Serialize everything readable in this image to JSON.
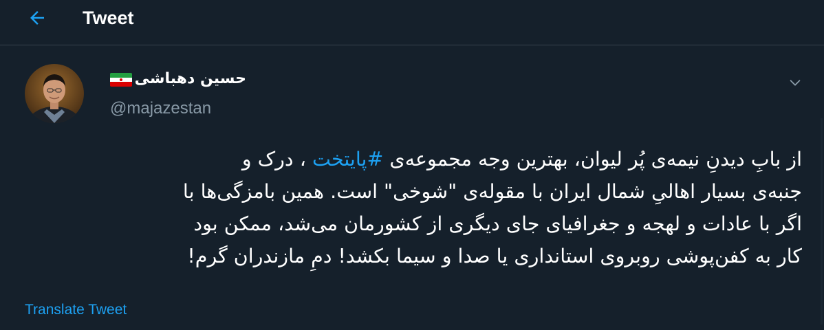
{
  "header": {
    "title": "Tweet",
    "back_icon": "arrow-left-icon"
  },
  "tweet": {
    "author": {
      "display_name": "حسین دهباشی",
      "handle": "@majazestan",
      "flag_icon": "iran-flag-icon"
    },
    "text_lines": {
      "line1_before": "از بابِ دیدنِ نیمه‌ی پُر لیوان، بهترین وجه مجموعه‌ی ",
      "hashtag": "#پایتخت",
      "line1_after": " ، درک و",
      "line2": "جنبه‌ی بسیار اهالیِ شمال ایران با مقوله‌ی \"شوخی\" است. همین بامزگی‌ها با",
      "line3": "اگر با عادات و لهجه و جغرافیای جای دیگری از کشورمان می‌شد، ممکن بود",
      "line4": "کار به کفن‌پوشی روبروی استانداری یا صدا و سیما بکشد! دمِ مازندران گرم!"
    },
    "translate_label": "Translate Tweet"
  },
  "colors": {
    "background": "#15202b",
    "accent": "#1da1f2",
    "secondary_text": "#8899a6",
    "divider": "#38444d"
  }
}
